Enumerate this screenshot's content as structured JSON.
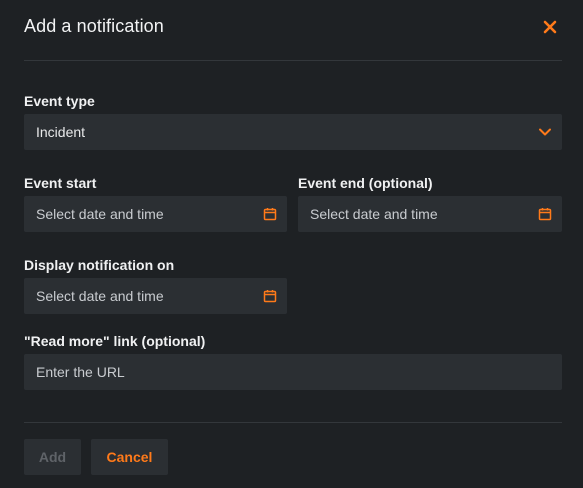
{
  "dialog": {
    "title": "Add a notification",
    "close_icon": "close-icon"
  },
  "fields": {
    "event_type": {
      "label": "Event type",
      "value": "Incident",
      "icon": "chevron-down-icon"
    },
    "event_start": {
      "label": "Event start",
      "placeholder": "Select date and time",
      "icon": "calendar-icon"
    },
    "event_end": {
      "label": "Event end (optional)",
      "placeholder": "Select date and time",
      "icon": "calendar-icon"
    },
    "display_on": {
      "label": "Display notification on",
      "placeholder": "Select date and time",
      "icon": "calendar-icon"
    },
    "read_more": {
      "label": "\"Read more\" link (optional)",
      "placeholder": "Enter the URL"
    }
  },
  "actions": {
    "add_label": "Add",
    "cancel_label": "Cancel"
  },
  "colors": {
    "background": "#1e2124",
    "field_background": "#2b2f33",
    "accent": "#ff7a1a",
    "divider": "#33373b",
    "disabled_text": "#5f6368"
  }
}
